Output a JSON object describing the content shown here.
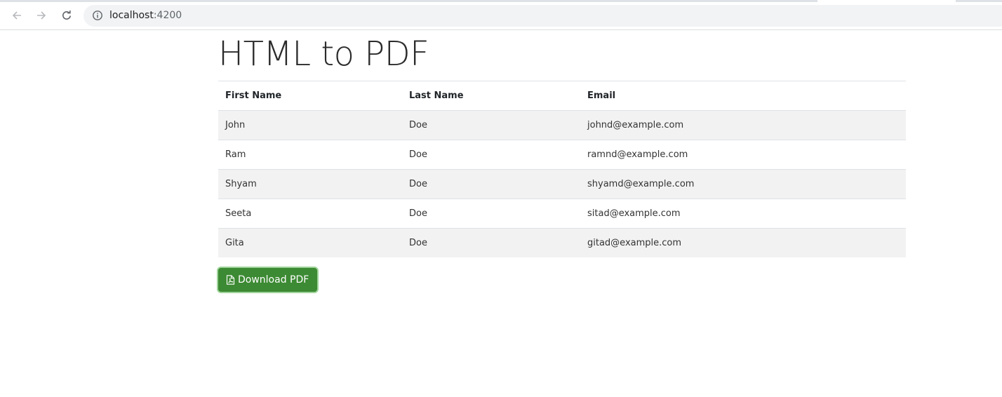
{
  "browser": {
    "url_host": "localhost",
    "url_port": ":4200",
    "icons": {
      "back": "arrow-left-icon",
      "forward": "arrow-right-icon",
      "reload": "reload-icon",
      "site_info": "info-icon"
    }
  },
  "page": {
    "title": "HTML to PDF",
    "table": {
      "headers": [
        "First Name",
        "Last Name",
        "Email"
      ],
      "rows": [
        [
          "John",
          "Doe",
          "johnd@example.com"
        ],
        [
          "Ram",
          "Doe",
          "ramnd@example.com"
        ],
        [
          "Shyam",
          "Doe",
          "shyamd@example.com"
        ],
        [
          "Seeta",
          "Doe",
          "sitad@example.com"
        ],
        [
          "Gita",
          "Doe",
          "gitad@example.com"
        ]
      ]
    },
    "download_button": {
      "label": "Download PDF",
      "icon": "file-pdf-icon",
      "color": "#3c8a33"
    }
  }
}
